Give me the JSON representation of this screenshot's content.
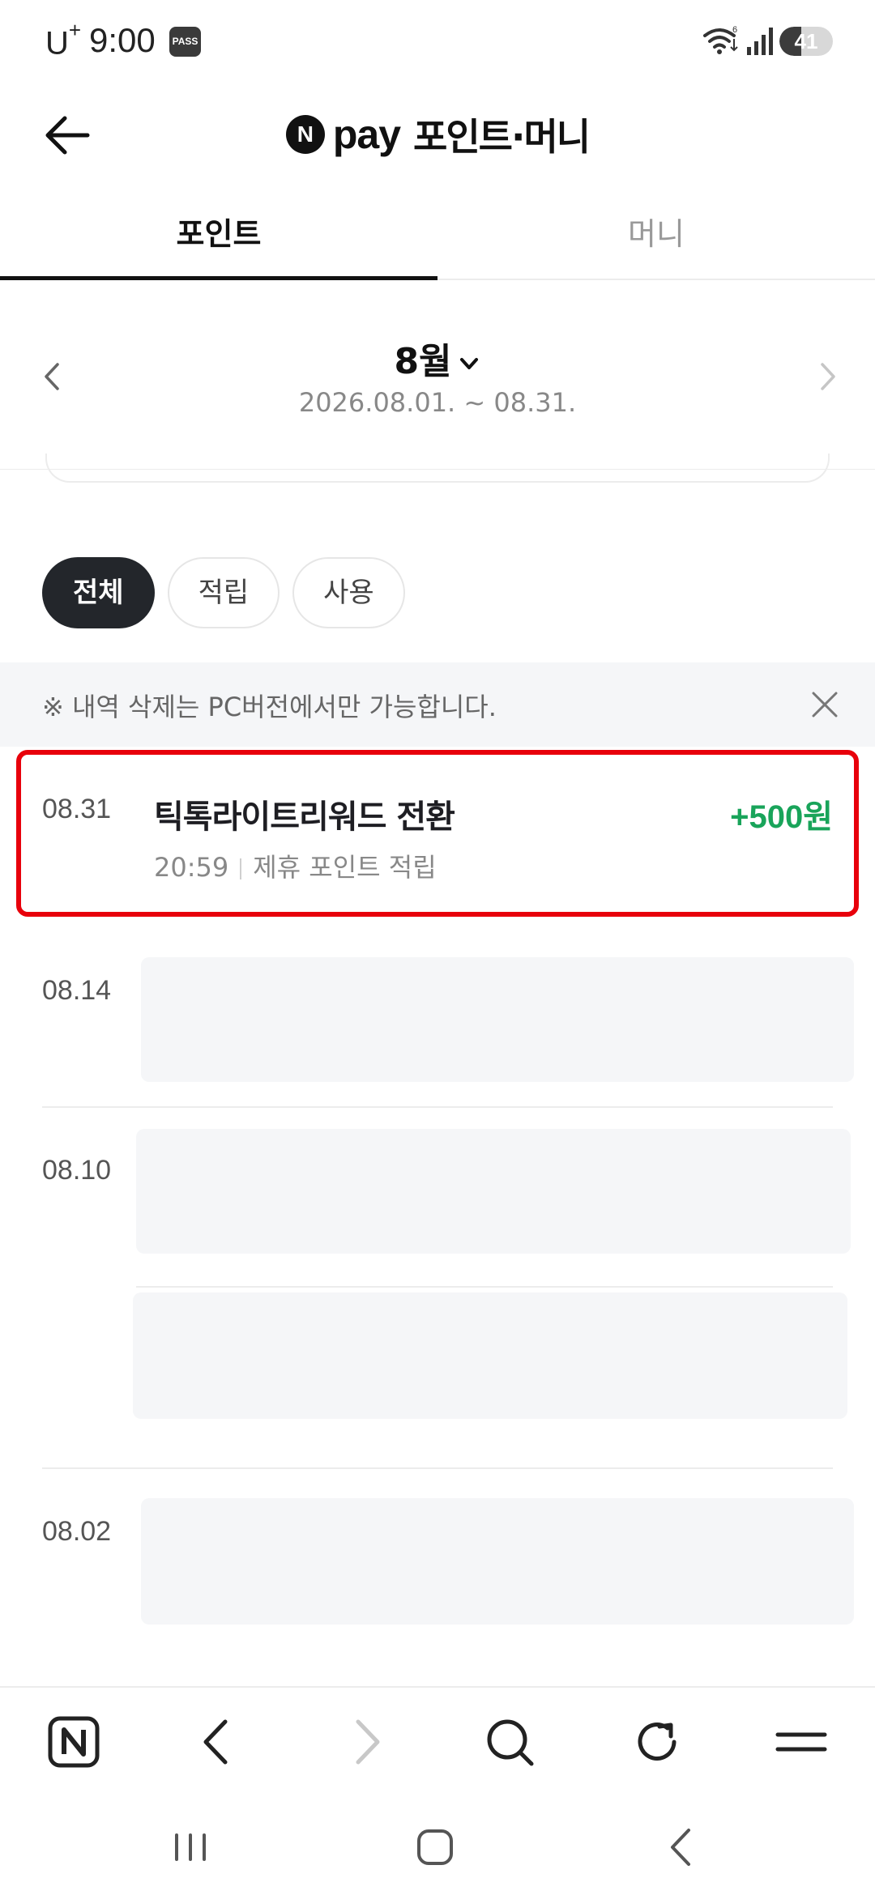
{
  "status_bar": {
    "carrier": "U",
    "carrier_sup": "+",
    "time": "9:00",
    "pass_badge": "PASS",
    "battery": "41",
    "battery_level": 0.41
  },
  "header": {
    "brand_letter": "N",
    "brand_pay": "pay",
    "title": "포인트·머니"
  },
  "tabs": [
    {
      "label": "포인트",
      "active": true
    },
    {
      "label": "머니",
      "active": false
    }
  ],
  "month": {
    "label": "8월",
    "range": "2026.08.01. ~ 08.31."
  },
  "filters": [
    {
      "label": "전체",
      "active": true
    },
    {
      "label": "적립",
      "active": false
    },
    {
      "label": "사용",
      "active": false
    }
  ],
  "notice": {
    "text": "※ 내역 삭제는 PC버전에서만 가능합니다."
  },
  "transactions": [
    {
      "date": "08.31",
      "title": "틱톡라이트리워드 전환",
      "amount": "+500원",
      "time": "20:59",
      "category": "제휴 포인트 적립"
    },
    {
      "date": "08.14"
    },
    {
      "date": "08.10"
    },
    {
      "date": "08.02"
    }
  ],
  "colors": {
    "accent_green": "#19a45a",
    "highlight_red": "#e8000b",
    "chip_active": "#23262b"
  }
}
